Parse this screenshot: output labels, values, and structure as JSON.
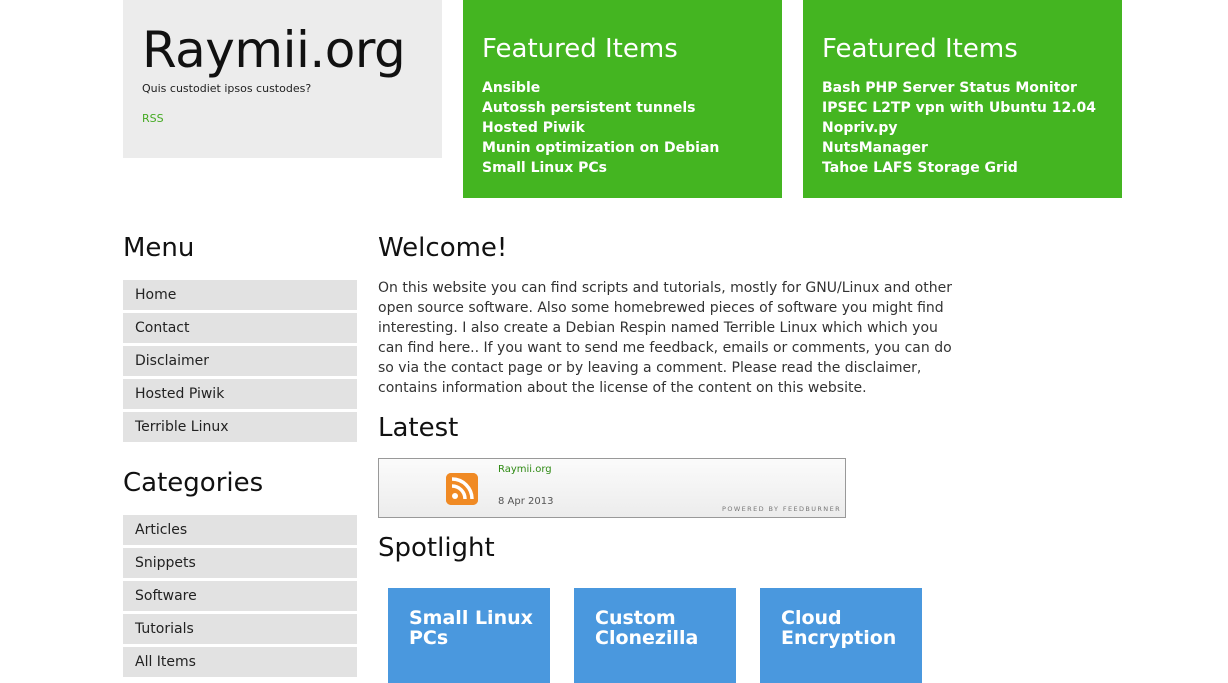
{
  "site": {
    "title": "Raymii.org",
    "tagline": "Quis custodiet ipsos custodes?",
    "rss_label": "RSS"
  },
  "featured": [
    {
      "title": "Featured Items",
      "items": [
        "Ansible",
        "Autossh persistent tunnels",
        "Hosted Piwik",
        "Munin optimization on Debian",
        "Small Linux PCs"
      ]
    },
    {
      "title": "Featured Items",
      "items": [
        "Bash PHP Server Status Monitor",
        "IPSEC L2TP vpn with Ubuntu 12.04",
        "Nopriv.py",
        "NutsManager",
        "Tahoe LAFS Storage Grid"
      ]
    }
  ],
  "sidebar": {
    "menu_heading": "Menu",
    "menu_items": [
      "Home",
      "Contact",
      "Disclaimer",
      "Hosted Piwik",
      "Terrible Linux"
    ],
    "categories_heading": "Categories",
    "category_items": [
      "Articles",
      "Snippets",
      "Software",
      "Tutorials",
      "All Items"
    ]
  },
  "main": {
    "welcome_heading": "Welcome!",
    "welcome_text": "On this website you can find scripts and tutorials, mostly for GNU/Linux and other open source software. Also some homebrewed pieces of software you might find interesting. I also create a Debian Respin named Terrible Linux which which you can find here.. If you want to send me feedback, emails or comments, you can do so via the contact page or by leaving a comment. Please read the disclaimer, contains information about the license of the content on this website.",
    "latest_heading": "Latest",
    "spotlight_heading": "Spotlight"
  },
  "feed": {
    "title": "Raymii.org",
    "date": "8 Apr 2013",
    "powered_by": "POWERED BY FEEDBURNER",
    "icon": "rss-feed-icon"
  },
  "spotlight": [
    "Small Linux PCs",
    "Custom Clonezilla",
    "Cloud Encryption"
  ],
  "colors": {
    "featured_bg": "#44b521",
    "spotlight_bg": "#4a98de",
    "brand_bg": "#ececec",
    "sidebar_item_bg": "#e2e2e2",
    "link_green": "#44aa22"
  }
}
